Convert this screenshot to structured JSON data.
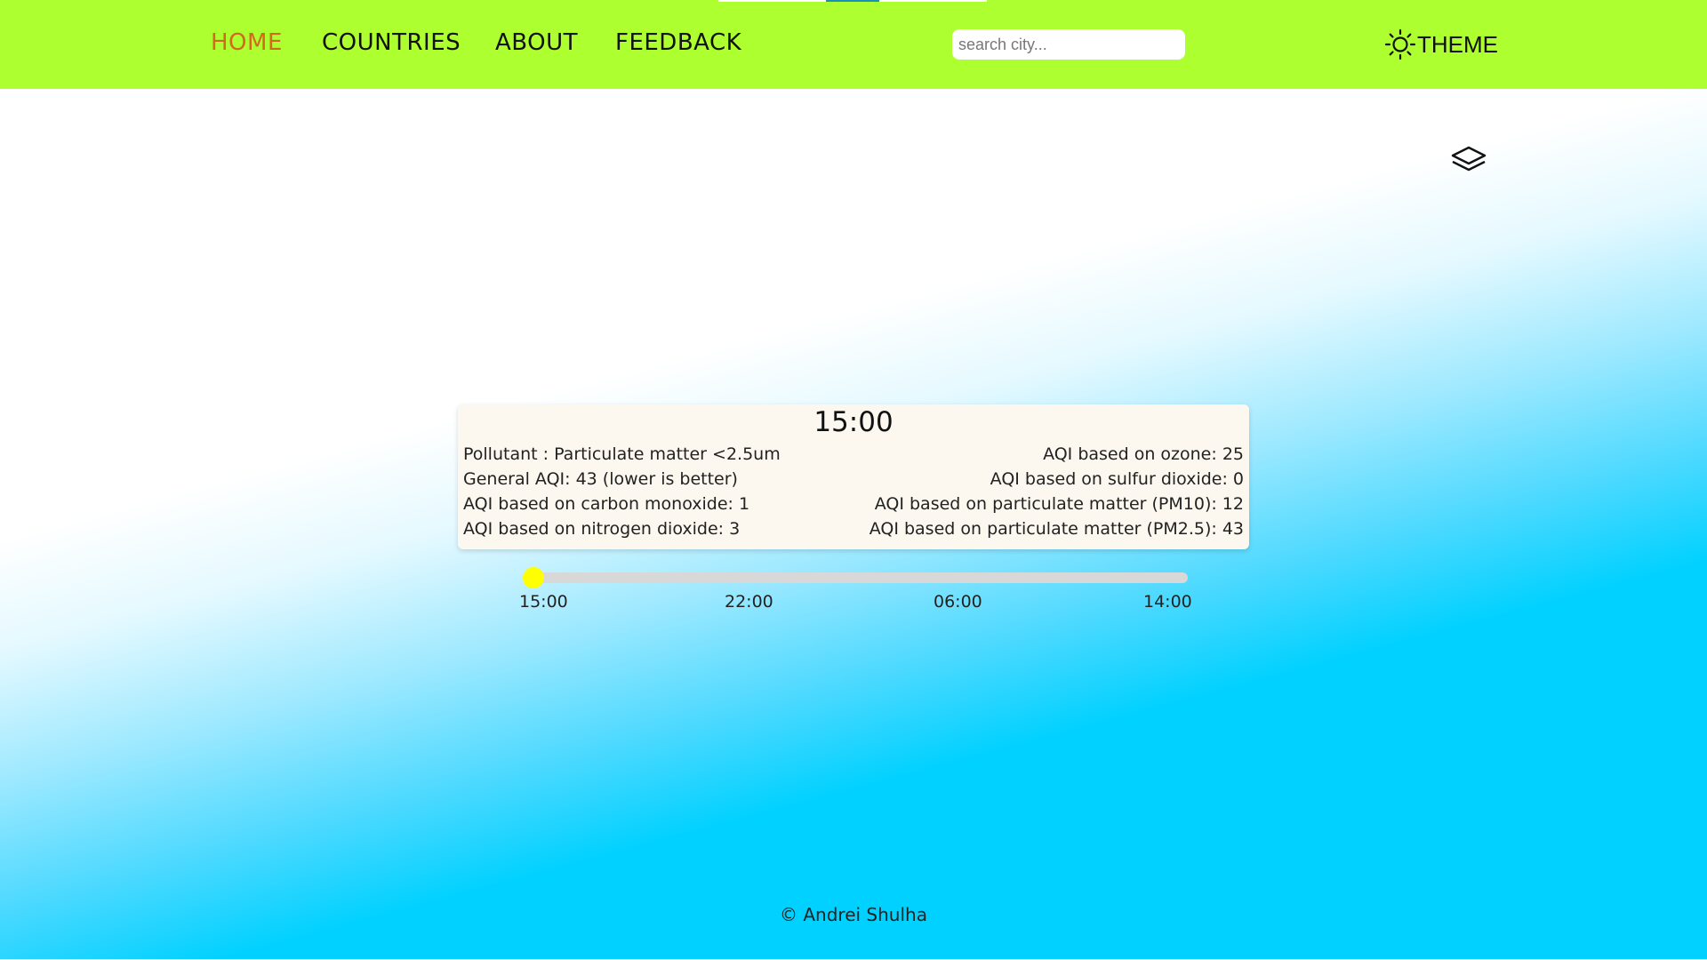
{
  "nav": {
    "items": [
      {
        "label": "HOME",
        "active": true
      },
      {
        "label": "COUNTRIES",
        "active": false
      },
      {
        "label": "ABOUT",
        "active": false
      },
      {
        "label": "FEEDBACK",
        "active": false
      }
    ]
  },
  "search": {
    "placeholder": "search city...",
    "value": ""
  },
  "theme": {
    "icon": "sun-icon",
    "label": "THEME"
  },
  "map_controls": {
    "layers_icon": "layers-icon"
  },
  "card": {
    "time": "15:00",
    "left_lines": [
      "Pollutant : Particulate matter <2.5um",
      "General AQI: 43 (lower is better)",
      "AQI based on carbon monoxide: 1",
      "AQI based on nitrogen dioxide: 3"
    ],
    "right_lines": [
      "AQI based on ozone: 25",
      "AQI based on sulfur dioxide: 0",
      "AQI based on particulate matter (PM10): 12",
      "AQI based on particulate matter (PM2.5): 43"
    ]
  },
  "timeline": {
    "value": 0,
    "ticks": [
      "15:00",
      "22:00",
      "06:00",
      "14:00"
    ]
  },
  "footer": {
    "copyright": "© Andrei Shulha"
  },
  "colors": {
    "header_bg": "#adff2f",
    "active_nav": "#d2691e",
    "accent_sky": "#00d1ff",
    "card_bg": "#fdf8ef",
    "slider_thumb": "#ffff00"
  }
}
